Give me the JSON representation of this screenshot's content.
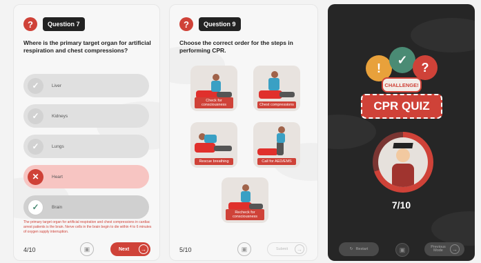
{
  "panel1": {
    "question_badge": "Question 7",
    "question": "Where is the primary target organ for artificial respiration and chest compressions?",
    "options": [
      {
        "label": "Liver",
        "state": "neutral"
      },
      {
        "label": "Kidneys",
        "state": "neutral"
      },
      {
        "label": "Lungs",
        "state": "neutral"
      },
      {
        "label": "Heart",
        "state": "wrong"
      },
      {
        "label": "Brain",
        "state": "correct"
      }
    ],
    "explanation": "The primary target organ for artificial respiration and chest compressions in cardiac arrest patients is the brain. Nerve cells in the brain begin to die within 4 to 6 minutes of oxygen supply interruption.",
    "page": "4/10",
    "next_label": "Next"
  },
  "panel2": {
    "question_badge": "Question 9",
    "question": "Choose the correct order for the steps in performing CPR.",
    "cards": [
      {
        "label": "Check for consciousness"
      },
      {
        "label": "Chest compressions"
      },
      {
        "label": "Rescue breathing"
      },
      {
        "label": "Call for AED/EMS"
      },
      {
        "label": "Recheck for consciousness"
      }
    ],
    "page": "5/10",
    "submit_label": "Submit"
  },
  "panel3": {
    "bubbles": [
      "!",
      "✓",
      "?"
    ],
    "challenge": "CHALLENGE!",
    "title": "CPR QUIZ",
    "score": "7/10",
    "score_fraction": 0.7,
    "restart_label": "Restart",
    "previous_label": "Previous Mode"
  },
  "colors": {
    "accent": "#cf4238",
    "dark_bg": "#262626",
    "correct": "#4a8b74"
  }
}
